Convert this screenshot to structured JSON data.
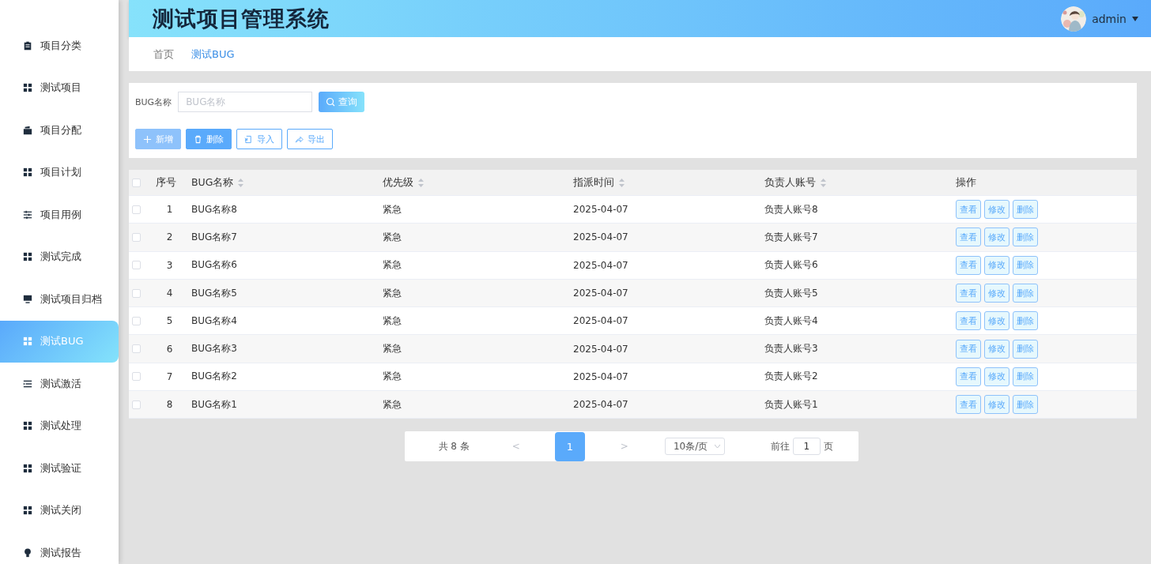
{
  "sidebar": {
    "items": [
      {
        "label": "项目分类",
        "kind": "clipboard",
        "selected": false
      },
      {
        "label": "测试项目",
        "kind": "grid",
        "selected": false
      },
      {
        "label": "项目分配",
        "kind": "wallet",
        "selected": false
      },
      {
        "label": "项目计划",
        "kind": "grid",
        "selected": false
      },
      {
        "label": "项目用例",
        "kind": "sliders",
        "selected": false
      },
      {
        "label": "测试完成",
        "kind": "grid",
        "selected": false
      },
      {
        "label": "测试项目归档",
        "kind": "monitor",
        "selected": false
      },
      {
        "label": "测试BUG",
        "kind": "grid",
        "selected": true
      },
      {
        "label": "测试激活",
        "kind": "list",
        "selected": false
      },
      {
        "label": "测试处理",
        "kind": "grid",
        "selected": false
      },
      {
        "label": "测试验证",
        "kind": "grid",
        "selected": false
      },
      {
        "label": "测试关闭",
        "kind": "grid",
        "selected": false
      },
      {
        "label": "测试报告",
        "kind": "bulb",
        "selected": false
      }
    ]
  },
  "header": {
    "title": "测试项目管理系统",
    "user": "admin"
  },
  "breadcrumb": [
    {
      "label": "首页",
      "selected": false
    },
    {
      "label": "测试BUG",
      "selected": true
    }
  ],
  "search": {
    "label": "BUG名称",
    "placeholder": "BUG名称",
    "button": "查询"
  },
  "toolbar": [
    {
      "label": "新增",
      "kind": "add"
    },
    {
      "label": "删除",
      "kind": "delete"
    },
    {
      "label": "导入",
      "kind": "import"
    },
    {
      "label": "导出",
      "kind": "export"
    }
  ],
  "table": {
    "all_checked": false,
    "columns": [
      {
        "label": "序号",
        "sortable": false
      },
      {
        "label": "BUG名称",
        "sortable": true
      },
      {
        "label": "优先级",
        "sortable": true
      },
      {
        "label": "指派时间",
        "sortable": true
      },
      {
        "label": "负责人账号",
        "sortable": true
      },
      {
        "label": "操作",
        "sortable": false
      }
    ],
    "rows": [
      {
        "index": "1",
        "name": "BUG名称8",
        "priority": "紧急",
        "time": "2025-04-07",
        "account": "负责人账号8",
        "checked": false,
        "actions": [
          "查看",
          "修改",
          "删除"
        ]
      },
      {
        "index": "2",
        "name": "BUG名称7",
        "priority": "紧急",
        "time": "2025-04-07",
        "account": "负责人账号7",
        "checked": false,
        "actions": [
          "查看",
          "修改",
          "删除"
        ]
      },
      {
        "index": "3",
        "name": "BUG名称6",
        "priority": "紧急",
        "time": "2025-04-07",
        "account": "负责人账号6",
        "checked": false,
        "actions": [
          "查看",
          "修改",
          "删除"
        ]
      },
      {
        "index": "4",
        "name": "BUG名称5",
        "priority": "紧急",
        "time": "2025-04-07",
        "account": "负责人账号5",
        "checked": false,
        "actions": [
          "查看",
          "修改",
          "删除"
        ]
      },
      {
        "index": "5",
        "name": "BUG名称4",
        "priority": "紧急",
        "time": "2025-04-07",
        "account": "负责人账号4",
        "checked": false,
        "actions": [
          "查看",
          "修改",
          "删除"
        ]
      },
      {
        "index": "6",
        "name": "BUG名称3",
        "priority": "紧急",
        "time": "2025-04-07",
        "account": "负责人账号3",
        "checked": false,
        "actions": [
          "查看",
          "修改",
          "删除"
        ]
      },
      {
        "index": "7",
        "name": "BUG名称2",
        "priority": "紧急",
        "time": "2025-04-07",
        "account": "负责人账号2",
        "checked": false,
        "actions": [
          "查看",
          "修改",
          "删除"
        ]
      },
      {
        "index": "8",
        "name": "BUG名称1",
        "priority": "紧急",
        "time": "2025-04-07",
        "account": "负责人账号1",
        "checked": false,
        "actions": [
          "查看",
          "修改",
          "删除"
        ]
      }
    ]
  },
  "pagination": {
    "total": "共 8 条",
    "prev": "<",
    "pages": [
      {
        "label": "1",
        "selected": true
      }
    ],
    "next": ">",
    "page_size": "10条/页",
    "goto_label": "前往",
    "goto_value": "1",
    "goto_suffix": "页"
  }
}
